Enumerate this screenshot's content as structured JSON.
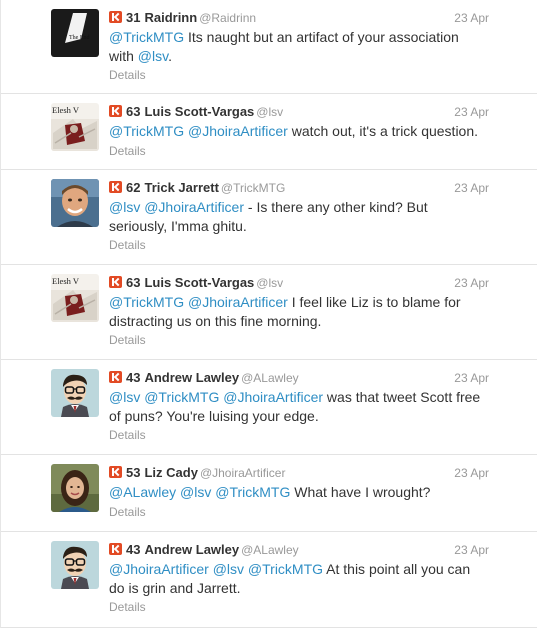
{
  "tweets": [
    {
      "avatar": "the-end-avatar",
      "avatar_text": "The End",
      "klout": "31",
      "name": "Raidrinn",
      "handle": "@Raidrinn",
      "date": "23 Apr",
      "line1": [
        {
          "t": "@TrickMTG",
          "m": true
        },
        {
          "t": " Its naught but an artifact of your association",
          "m": false
        }
      ],
      "line2": [
        {
          "t": "with ",
          "m": false
        },
        {
          "t": "@lsv",
          "m": true
        },
        {
          "t": ".",
          "m": false
        }
      ],
      "details": "Details"
    },
    {
      "avatar": "elesh-card-avatar",
      "avatar_text": "Elesh V",
      "klout": "63",
      "name": "Luis Scott-Vargas",
      "handle": "@lsv",
      "date": "23 Apr",
      "line1": [
        {
          "t": "@TrickMTG",
          "m": true
        },
        {
          "t": " ",
          "m": false
        },
        {
          "t": "@JhoiraArtificer",
          "m": true
        },
        {
          "t": " watch out, it's a trick question.",
          "m": false
        }
      ],
      "line2": [],
      "details": "Details"
    },
    {
      "avatar": "photo-avatar",
      "klout": "62",
      "name": "Trick Jarrett",
      "handle": "@TrickMTG",
      "date": "23 Apr",
      "line1": [
        {
          "t": "@lsv",
          "m": true
        },
        {
          "t": " ",
          "m": false
        },
        {
          "t": "@JhoiraArtificer",
          "m": true
        },
        {
          "t": " - Is there any other kind? But",
          "m": false
        }
      ],
      "line2": [
        {
          "t": "seriously, I'mma ghitu.",
          "m": false
        }
      ],
      "details": "Details"
    },
    {
      "avatar": "elesh-card-avatar",
      "avatar_text": "Elesh V",
      "klout": "63",
      "name": "Luis Scott-Vargas",
      "handle": "@lsv",
      "date": "23 Apr",
      "line1": [
        {
          "t": "@TrickMTG",
          "m": true
        },
        {
          "t": " ",
          "m": false
        },
        {
          "t": "@JhoiraArtificer",
          "m": true
        },
        {
          "t": " I feel like Liz is to blame for",
          "m": false
        }
      ],
      "line2": [
        {
          "t": "distracting us on this fine morning.",
          "m": false
        }
      ],
      "details": "Details"
    },
    {
      "avatar": "mustache-cartoon-avatar",
      "klout": "43",
      "name": "Andrew Lawley",
      "handle": "@ALawley",
      "date": "23 Apr",
      "line1": [
        {
          "t": "@lsv",
          "m": true
        },
        {
          "t": " ",
          "m": false
        },
        {
          "t": "@TrickMTG",
          "m": true
        },
        {
          "t": " ",
          "m": false
        },
        {
          "t": "@JhoiraArtificer",
          "m": true
        },
        {
          "t": " was that tweet Scott free",
          "m": false
        }
      ],
      "line2": [
        {
          "t": "of puns? You're luising your edge.",
          "m": false
        }
      ],
      "details": "Details"
    },
    {
      "avatar": "photo-avatar-woman",
      "klout": "53",
      "name": "Liz Cady",
      "handle": "@JhoiraArtificer",
      "date": "23 Apr",
      "line1": [
        {
          "t": "@ALawley",
          "m": true
        },
        {
          "t": " ",
          "m": false
        },
        {
          "t": "@lsv",
          "m": true
        },
        {
          "t": " ",
          "m": false
        },
        {
          "t": "@TrickMTG",
          "m": true
        },
        {
          "t": " What have I wrought?",
          "m": false
        }
      ],
      "line2": [],
      "details": "Details"
    },
    {
      "avatar": "mustache-cartoon-avatar",
      "klout": "43",
      "name": "Andrew Lawley",
      "handle": "@ALawley",
      "date": "23 Apr",
      "line1": [
        {
          "t": "@JhoiraArtificer",
          "m": true
        },
        {
          "t": " ",
          "m": false
        },
        {
          "t": "@lsv",
          "m": true
        },
        {
          "t": " ",
          "m": false
        },
        {
          "t": "@TrickMTG",
          "m": true
        },
        {
          "t": " At this point all you can",
          "m": false
        }
      ],
      "line2": [
        {
          "t": "do is grin and Jarrett.",
          "m": false
        }
      ],
      "details": "Details"
    }
  ],
  "colors": {
    "mention": "#2f8ec4",
    "klout": "#e24a24",
    "meta": "#999999",
    "text": "#333333"
  }
}
